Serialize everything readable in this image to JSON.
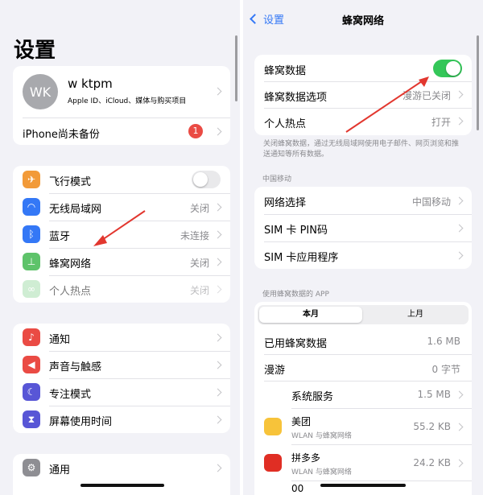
{
  "left": {
    "title": "设置",
    "profile": {
      "initials": "WK",
      "name": "w ktpm",
      "subtitle": "Apple ID、iCloud、媒体与购买项目"
    },
    "backup": {
      "label": "iPhone尚未备份",
      "badge": "1"
    },
    "group1": [
      {
        "label": "飞行模式",
        "icon": "airplane-icon",
        "color": "#f29a38"
      },
      {
        "label": "无线局域网",
        "value": "关闭",
        "icon": "wifi-icon",
        "color": "#3478f6"
      },
      {
        "label": "蓝牙",
        "value": "未连接",
        "icon": "bluetooth-icon",
        "color": "#3478f6"
      },
      {
        "label": "蜂窝网络",
        "value": "关闭",
        "icon": "cellular-antenna-icon",
        "color": "#5ec36a"
      },
      {
        "label": "个人热点",
        "value": "关闭",
        "icon": "hotspot-link-icon",
        "color": "#a8deb0"
      }
    ],
    "group2": [
      {
        "label": "通知",
        "icon": "bell-icon",
        "color": "#ea4b44"
      },
      {
        "label": "声音与触感",
        "icon": "speaker-icon",
        "color": "#ea4b44"
      },
      {
        "label": "专注模式",
        "icon": "moon-icon",
        "color": "#5856d6"
      },
      {
        "label": "屏幕使用时间",
        "icon": "hourglass-icon",
        "color": "#5856d6"
      }
    ],
    "group3": [
      {
        "label": "通用",
        "icon": "gear-icon",
        "color": "#8e8e93"
      }
    ]
  },
  "right": {
    "back": "设置",
    "title": "蜂窝网络",
    "group1": [
      {
        "label": "蜂窝数据",
        "toggle": true
      },
      {
        "label": "蜂窝数据选项",
        "value": "漫游已关闭"
      },
      {
        "label": "个人热点",
        "value": "打开"
      }
    ],
    "footnote": "关闭蜂窝数据，通过无线局域网使用电子邮件、网页浏览和推送通知等所有数据。",
    "carrier_header": "中国移动",
    "group2": [
      {
        "label": "网络选择",
        "value": "中国移动"
      },
      {
        "label": "SIM 卡 PIN码"
      },
      {
        "label": "SIM 卡应用程序"
      }
    ],
    "apps_header": "使用蜂窝数据的 APP",
    "segments": [
      "本月",
      "上月"
    ],
    "stats": [
      {
        "label": "已用蜂窝数据",
        "value": "1.6 MB"
      },
      {
        "label": "漫游",
        "value": "0 字节"
      }
    ],
    "system_services": {
      "label": "系统服务",
      "value": "1.5 MB"
    },
    "apps": [
      {
        "name": "美团",
        "sub": "WLAN 与蜂窝网络",
        "value": "55.2 KB",
        "color": "#f7c33a"
      },
      {
        "name": "拼多多",
        "sub": "WLAN 与蜂窝网络",
        "value": "24.2 KB",
        "color": "#e02e24"
      }
    ],
    "partial_app": "00"
  },
  "colors": {
    "accent": "#3478f6",
    "toggle_on": "#34c759",
    "badge": "#ea4b44",
    "arrow": "#e2372f"
  }
}
